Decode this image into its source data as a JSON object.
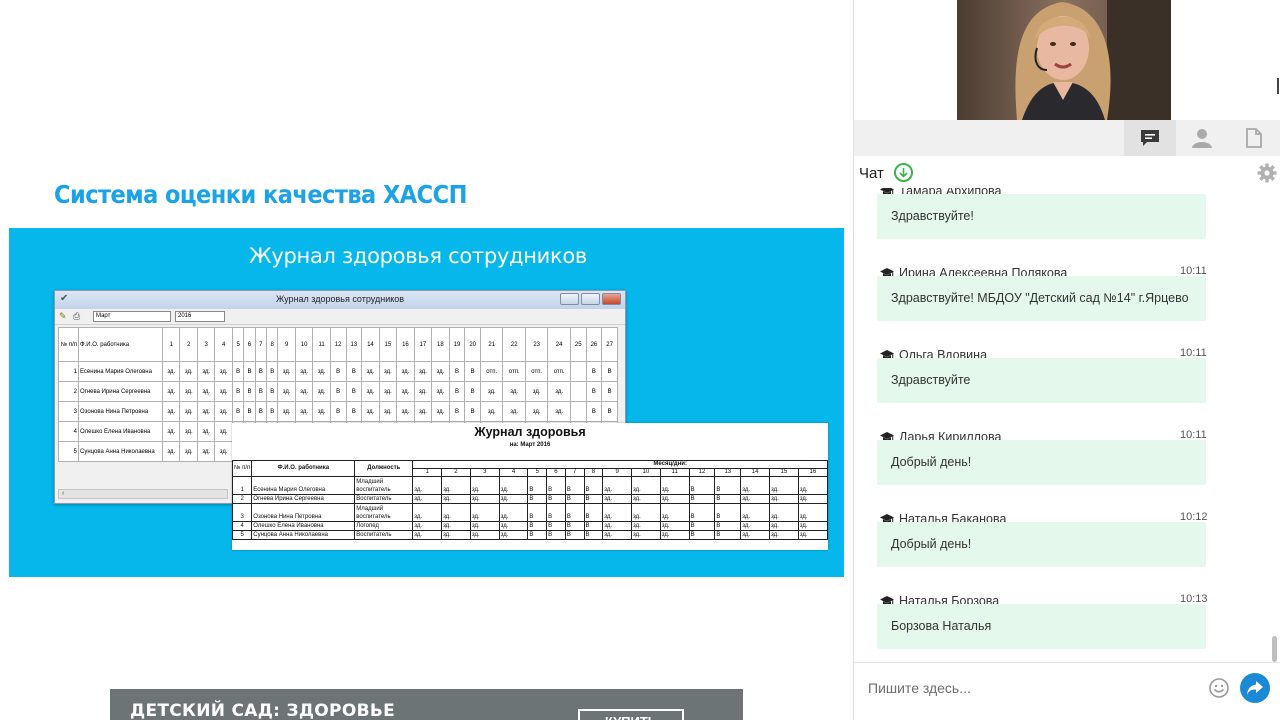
{
  "slide": {
    "title": "Система оценки качества ХАССП",
    "band_title": "Журнал здоровья сотрудников",
    "app_window": {
      "title": "Журнал здоровья сотрудников",
      "month": "Март",
      "year": "2016",
      "col_num_header": "№ п/п",
      "col_name_header": "Ф.И.О. работника",
      "day_headers": [
        "1",
        "2",
        "3",
        "4",
        "5",
        "6",
        "7",
        "8",
        "9",
        "10",
        "11",
        "12",
        "13",
        "14",
        "15",
        "16",
        "17",
        "18",
        "19",
        "20",
        "21",
        "22",
        "23",
        "24",
        "25",
        "26",
        "27"
      ],
      "rows": [
        {
          "num": "1",
          "name": "Есенина Мария Олеговна",
          "cells": [
            "зд.",
            "зд.",
            "зд.",
            "зд.",
            "В",
            "В",
            "В",
            "В",
            "зд.",
            "зд.",
            "зд.",
            "В",
            "В",
            "зд.",
            "зд.",
            "зд.",
            "зд.",
            "зд.",
            "В",
            "В",
            "отп.",
            "отп.",
            "отп.",
            "отп.",
            "",
            "В",
            "В"
          ]
        },
        {
          "num": "2",
          "name": "Огнева Ирина Сергеевна",
          "cells": [
            "зд.",
            "зд.",
            "зд.",
            "зд.",
            "В",
            "В",
            "В",
            "В",
            "зд.",
            "зд.",
            "зд.",
            "В",
            "В",
            "зд.",
            "зд.",
            "зд.",
            "зд.",
            "зд.",
            "В",
            "В",
            "зд.",
            "зд.",
            "зд.",
            "зд.",
            "",
            "В",
            "В"
          ]
        },
        {
          "num": "3",
          "name": "Озонова Нина Петровна",
          "cells": [
            "зд.",
            "зд.",
            "зд.",
            "зд.",
            "В",
            "В",
            "В",
            "В",
            "зд.",
            "зд.",
            "зд.",
            "В",
            "В",
            "зд.",
            "зд.",
            "зд.",
            "зд.",
            "зд.",
            "В",
            "В",
            "зд.",
            "зд.",
            "зд.",
            "зд.",
            "",
            "В",
            "В"
          ]
        },
        {
          "num": "4",
          "name": "Олешко Елена Ивановна",
          "cells": [
            "зд.",
            "зд.",
            "зд.",
            "зд.",
            "",
            "",
            "",
            "",
            "",
            "",
            "",
            "",
            "",
            "",
            "",
            "",
            "",
            "",
            "",
            "",
            "",
            "",
            "",
            "",
            "",
            "",
            ""
          ]
        },
        {
          "num": "5",
          "name": "Сунцова Анна Николаевна",
          "cells": [
            "зд.",
            "зд.",
            "зд.",
            "зд.",
            "",
            "",
            "",
            "",
            "",
            "",
            "",
            "",
            "",
            "",
            "",
            "",
            "",
            "",
            "",
            "",
            "",
            "",
            "",
            "",
            "",
            "",
            ""
          ]
        }
      ]
    },
    "report": {
      "title": "Журнал здоровья",
      "subtitle": "на: Март 2016",
      "col_num": "№ п/п",
      "col_name": "Ф.И.О. работника",
      "col_position": "Должность",
      "col_month_days": "Месяц/дни:",
      "day_headers": [
        "1",
        "2",
        "3",
        "4",
        "5",
        "6",
        "7",
        "8",
        "9",
        "10",
        "11",
        "12",
        "13",
        "14",
        "15",
        "16"
      ],
      "rows": [
        {
          "num": "1",
          "name": "Есенина Мария Олеговна",
          "pos1": "Младший",
          "pos2": "воспитатель",
          "cells": [
            "зд.",
            "зд.",
            "зд.",
            "зд.",
            "В",
            "В",
            "В",
            "В",
            "зд.",
            "зд.",
            "зд.",
            "В",
            "В",
            "зд.",
            "зд.",
            "зд."
          ]
        },
        {
          "num": "2",
          "name": "Огнева Ирина Сергеевна",
          "pos1": "",
          "pos2": "Воспитатель",
          "cells": [
            "зд.",
            "зд.",
            "зд.",
            "зд.",
            "В",
            "В",
            "В",
            "В",
            "зд.",
            "зд.",
            "зд.",
            "В",
            "В",
            "зд.",
            "зд.",
            "зд."
          ]
        },
        {
          "num": "3",
          "name": "Озонова Нина Петровна",
          "pos1": "Младший",
          "pos2": "воспитатель",
          "cells": [
            "зд.",
            "зд.",
            "зд.",
            "зд.",
            "В",
            "В",
            "В",
            "В",
            "зд.",
            "зд.",
            "зд.",
            "В",
            "В",
            "зд.",
            "зд.",
            "зд."
          ]
        },
        {
          "num": "4",
          "name": "Олешко Елена Ивановна",
          "pos1": "",
          "pos2": "Логопед",
          "cells": [
            "зд.",
            "зд.",
            "зд.",
            "зд.",
            "В",
            "В",
            "В",
            "В",
            "зд.",
            "зд.",
            "зд.",
            "В",
            "В",
            "зд.",
            "зд.",
            "зд."
          ]
        },
        {
          "num": "5",
          "name": "Сунцова Анна Николаевна",
          "pos1": "",
          "pos2": "Воспитатель",
          "cells": [
            "зд.",
            "зд.",
            "зд.",
            "зд.",
            "В",
            "В",
            "В",
            "В",
            "зд.",
            "зд.",
            "зд.",
            "В",
            "В",
            "зд.",
            "зд.",
            "зд."
          ]
        }
      ]
    },
    "ad_banner": {
      "text": "ДЕТСКИЙ САД: ЗДОРОВЬЕ",
      "button": "КУПИТЬ"
    }
  },
  "panel": {
    "tabs": [
      {
        "icon": "chat-bubble-icon",
        "active": true
      },
      {
        "icon": "user-icon",
        "active": false
      },
      {
        "icon": "document-icon",
        "active": false
      }
    ],
    "chat": {
      "title": "Чат",
      "messages": [
        {
          "author": "Тамара Архипова",
          "time": "",
          "text": "Здравствуйте!"
        },
        {
          "author": "Ирина Алексеевна Полякова",
          "time": "10:11",
          "text": "Здравствуйте! МБДОУ \"Детский сад №14\" г.Ярцево"
        },
        {
          "author": "Ольга Вдовина",
          "time": "10:11",
          "text": "Здравствуйте"
        },
        {
          "author": "Дарья Кириллова",
          "time": "10:11",
          "text": "Добрый день!"
        },
        {
          "author": "Наталья Баканова",
          "time": "10:12",
          "text": "Добрый день!"
        },
        {
          "author": "Наталья Борзова",
          "time": "10:13",
          "text": "Борзова Наталья"
        }
      ],
      "input_placeholder": "Пишите здесь..."
    },
    "colors": {
      "accent_blue": "#05b7eb",
      "title_blue": "#1aa3e6",
      "bubble_green": "#e5f8ec",
      "download_green": "#39b54a",
      "send_blue": "#1b8ad6"
    }
  }
}
